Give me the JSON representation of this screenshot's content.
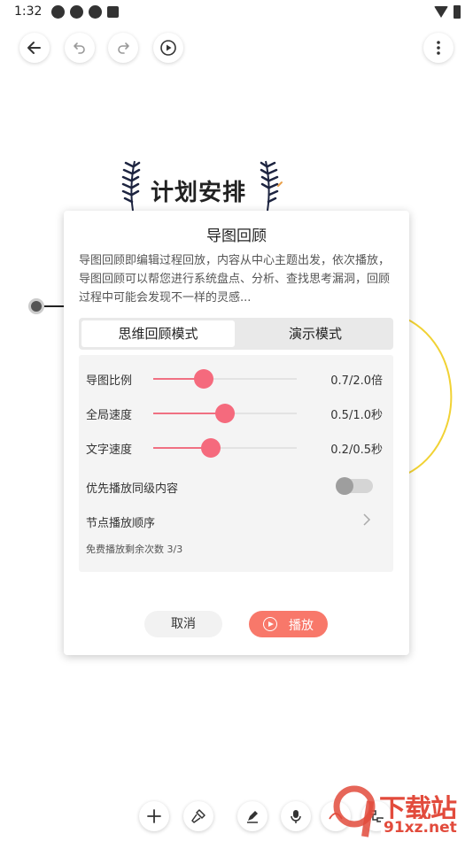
{
  "status_bar": {
    "time": "1:32"
  },
  "colors": {
    "accent": "#f56a7d",
    "play_button": "#f8786a",
    "yellow_branch": "#f1d234"
  },
  "toolbar": {
    "icons": [
      "back-arrow-icon",
      "undo-icon",
      "redo-icon",
      "play-circle-icon",
      "more-vertical-icon"
    ]
  },
  "canvas": {
    "central_topic": "计划安排"
  },
  "dialog": {
    "title": "导图回顾",
    "description": "导图回顾即编辑过程回放，内容从中心主题出发，依次播放，导图回顾可以帮您进行系统盘点、分析、查找思考漏洞，回顾过程中可能会发现不一样的灵感...",
    "tabs": [
      {
        "label": "思维回顾模式",
        "active": true
      },
      {
        "label": "演示模式",
        "active": false
      }
    ],
    "sliders": [
      {
        "label": "导图比例",
        "value_text": "0.7/2.0倍",
        "fraction": 0.35
      },
      {
        "label": "全局速度",
        "value_text": "0.5/1.0秒",
        "fraction": 0.5
      },
      {
        "label": "文字速度",
        "value_text": "0.2/0.5秒",
        "fraction": 0.4
      }
    ],
    "toggle": {
      "label": "优先播放同级内容",
      "on": false
    },
    "node_order": {
      "label": "节点播放顺序"
    },
    "free_count": "免费播放剩余次数   3/3",
    "cancel_label": "取消",
    "play_label": "播放"
  },
  "bottom_toolbar": {
    "icons": [
      "add-icon",
      "format-brush-icon",
      "pen-icon",
      "microphone-icon",
      "link-curve-icon",
      "node-layout-icon"
    ]
  },
  "watermark": {
    "brand": "下载站",
    "url_prefix": "91xz",
    "url_suffix": ".net"
  }
}
